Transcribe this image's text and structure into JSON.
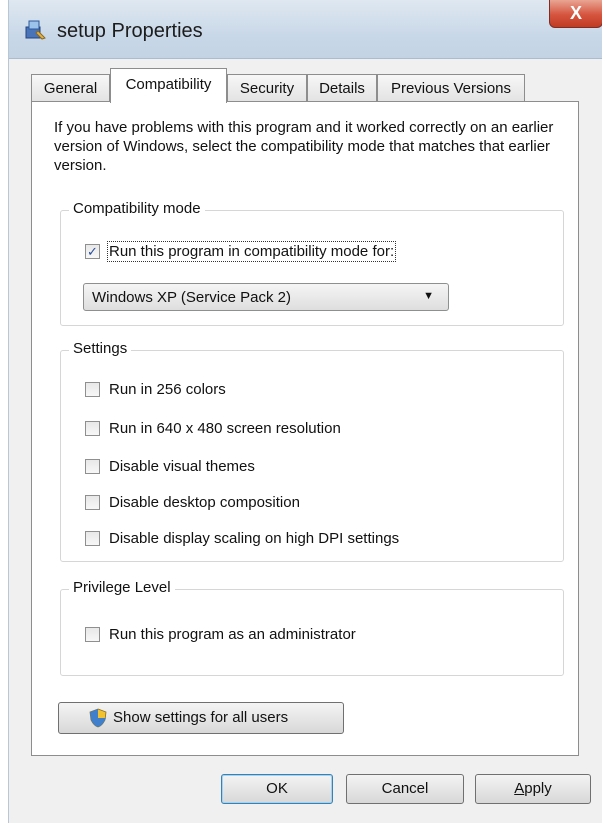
{
  "window": {
    "title": "setup Properties",
    "close_glyph": "X"
  },
  "tabs": [
    {
      "label": "General"
    },
    {
      "label": "Compatibility",
      "active": true
    },
    {
      "label": "Security"
    },
    {
      "label": "Details"
    },
    {
      "label": "Previous Versions"
    }
  ],
  "compatibility": {
    "intro": "If you have problems with this program and it worked correctly on an earlier version of Windows, select the compatibility mode that matches that earlier version.",
    "mode_group": {
      "title": "Compatibility mode",
      "checkbox_label": "Run this program in compatibility mode for:",
      "checked": true,
      "selected_os": "Windows XP (Service Pack 2)"
    },
    "settings_group": {
      "title": "Settings",
      "items": [
        {
          "label": "Run in 256 colors",
          "checked": false
        },
        {
          "label": "Run in 640 x 480 screen resolution",
          "checked": false
        },
        {
          "label": "Disable visual themes",
          "checked": false
        },
        {
          "label": "Disable desktop composition",
          "checked": false
        },
        {
          "label": "Disable display scaling on high DPI settings",
          "checked": false
        }
      ]
    },
    "privilege_group": {
      "title": "Privilege Level",
      "checkbox_label": "Run this program as an administrator",
      "checked": false
    },
    "all_users_button": "Show settings for all users"
  },
  "footer": {
    "ok": "OK",
    "cancel": "Cancel",
    "apply": "Apply"
  },
  "icons": {
    "app": "installer-icon",
    "shield": "uac-shield-icon",
    "dropdown": "chevron-down-icon"
  },
  "colors": {
    "close_button": "#c23b23",
    "checkmark": "#2a4e9b"
  }
}
